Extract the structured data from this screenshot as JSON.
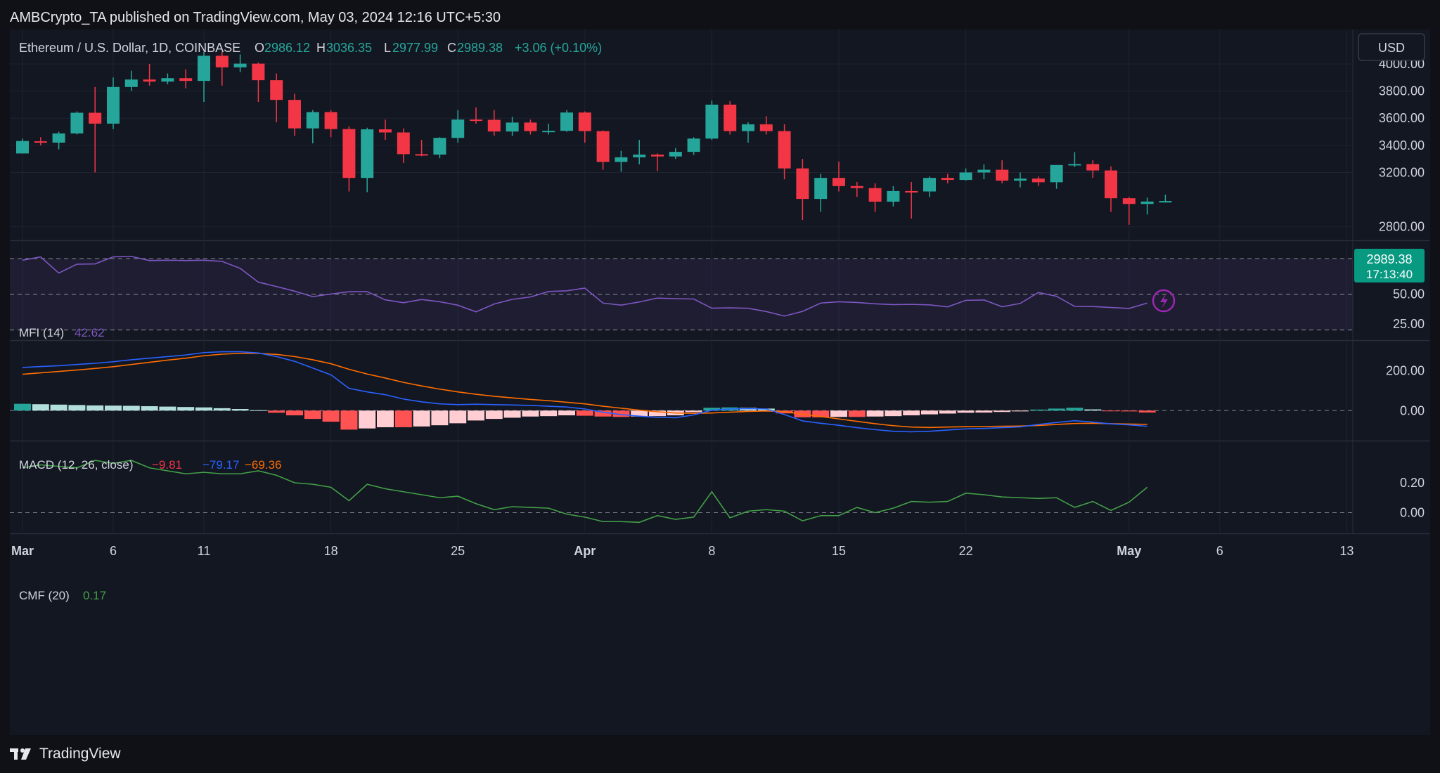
{
  "publish_line": "AMBCrypto_TA published on TradingView.com, May 03, 2024 12:16 UTC+5:30",
  "footer_brand": "TradingView",
  "colors": {
    "background": "#131722",
    "up": "#26a69a",
    "down": "#f23645",
    "mfi": "#7e57c2",
    "macd": "#2962ff",
    "signal": "#ff6d00",
    "cmf": "#43a047",
    "price_badge": "#089981"
  },
  "header": {
    "symbol": "Ethereum / U.S. Dollar, 1D, COINBASE",
    "o_label": "O",
    "o_value": "2986.12",
    "h_label": "H",
    "h_value": "3036.35",
    "l_label": "L",
    "l_value": "2977.99",
    "c_label": "C",
    "c_value": "2989.38",
    "change": "+3.06 (+0.10%)"
  },
  "currency_button": "USD",
  "last_price": {
    "price": "2989.38",
    "countdown": "17:13:40"
  },
  "chart_data": [
    {
      "type": "candlestick",
      "title": "Ethereum / U.S. Dollar, 1D, COINBASE",
      "ylim": [
        2700,
        4150
      ],
      "y_ticks": [
        "2800.00",
        "3200.00",
        "3400.00",
        "3600.00",
        "3800.00",
        "4000.00"
      ],
      "x_ticks": [
        "Mar",
        "6",
        "11",
        "18",
        "25",
        "Apr",
        "8",
        "15",
        "22",
        "May",
        "6",
        "13"
      ],
      "candles": [
        {
          "date": "2024-03-01",
          "o": 3340,
          "h": 3450,
          "l": 3340,
          "c": 3432
        },
        {
          "date": "2024-03-02",
          "o": 3430,
          "h": 3460,
          "l": 3400,
          "c": 3420
        },
        {
          "date": "2024-03-03",
          "o": 3420,
          "h": 3500,
          "l": 3370,
          "c": 3488
        },
        {
          "date": "2024-03-04",
          "o": 3488,
          "h": 3650,
          "l": 3480,
          "c": 3640
        },
        {
          "date": "2024-03-05",
          "o": 3640,
          "h": 3830,
          "l": 3200,
          "c": 3560
        },
        {
          "date": "2024-03-06",
          "o": 3560,
          "h": 3900,
          "l": 3520,
          "c": 3830
        },
        {
          "date": "2024-03-07",
          "o": 3830,
          "h": 3950,
          "l": 3800,
          "c": 3885
        },
        {
          "date": "2024-03-08",
          "o": 3885,
          "h": 4000,
          "l": 3840,
          "c": 3870
        },
        {
          "date": "2024-03-09",
          "o": 3870,
          "h": 3930,
          "l": 3850,
          "c": 3895
        },
        {
          "date": "2024-03-10",
          "o": 3895,
          "h": 3960,
          "l": 3820,
          "c": 3875
        },
        {
          "date": "2024-03-11",
          "o": 3875,
          "h": 4090,
          "l": 3720,
          "c": 4060
        },
        {
          "date": "2024-03-12",
          "o": 4060,
          "h": 4090,
          "l": 3840,
          "c": 3975
        },
        {
          "date": "2024-03-13",
          "o": 3975,
          "h": 4070,
          "l": 3940,
          "c": 4002
        },
        {
          "date": "2024-03-14",
          "o": 4002,
          "h": 4010,
          "l": 3720,
          "c": 3880
        },
        {
          "date": "2024-03-15",
          "o": 3880,
          "h": 3930,
          "l": 3570,
          "c": 3735
        },
        {
          "date": "2024-03-16",
          "o": 3735,
          "h": 3780,
          "l": 3470,
          "c": 3525
        },
        {
          "date": "2024-03-17",
          "o": 3525,
          "h": 3660,
          "l": 3415,
          "c": 3645
        },
        {
          "date": "2024-03-18",
          "o": 3645,
          "h": 3660,
          "l": 3460,
          "c": 3520
        },
        {
          "date": "2024-03-19",
          "o": 3520,
          "h": 3540,
          "l": 3060,
          "c": 3160
        },
        {
          "date": "2024-03-20",
          "o": 3160,
          "h": 3530,
          "l": 3055,
          "c": 3518
        },
        {
          "date": "2024-03-21",
          "o": 3518,
          "h": 3590,
          "l": 3440,
          "c": 3495
        },
        {
          "date": "2024-03-22",
          "o": 3495,
          "h": 3525,
          "l": 3270,
          "c": 3335
        },
        {
          "date": "2024-03-23",
          "o": 3335,
          "h": 3440,
          "l": 3320,
          "c": 3332
        },
        {
          "date": "2024-03-24",
          "o": 3332,
          "h": 3460,
          "l": 3305,
          "c": 3455
        },
        {
          "date": "2024-03-25",
          "o": 3455,
          "h": 3660,
          "l": 3420,
          "c": 3590
        },
        {
          "date": "2024-03-26",
          "o": 3590,
          "h": 3680,
          "l": 3560,
          "c": 3588
        },
        {
          "date": "2024-03-27",
          "o": 3588,
          "h": 3660,
          "l": 3470,
          "c": 3502
        },
        {
          "date": "2024-03-28",
          "o": 3502,
          "h": 3610,
          "l": 3470,
          "c": 3568
        },
        {
          "date": "2024-03-29",
          "o": 3568,
          "h": 3590,
          "l": 3480,
          "c": 3505
        },
        {
          "date": "2024-03-30",
          "o": 3505,
          "h": 3560,
          "l": 3480,
          "c": 3507
        },
        {
          "date": "2024-03-31",
          "o": 3507,
          "h": 3660,
          "l": 3500,
          "c": 3642
        },
        {
          "date": "2024-04-01",
          "o": 3642,
          "h": 3650,
          "l": 3420,
          "c": 3505
        },
        {
          "date": "2024-04-02",
          "o": 3505,
          "h": 3510,
          "l": 3220,
          "c": 3278
        },
        {
          "date": "2024-04-03",
          "o": 3278,
          "h": 3360,
          "l": 3205,
          "c": 3312
        },
        {
          "date": "2024-04-04",
          "o": 3312,
          "h": 3440,
          "l": 3260,
          "c": 3332
        },
        {
          "date": "2024-04-05",
          "o": 3332,
          "h": 3340,
          "l": 3210,
          "c": 3318
        },
        {
          "date": "2024-04-06",
          "o": 3318,
          "h": 3380,
          "l": 3300,
          "c": 3352
        },
        {
          "date": "2024-04-07",
          "o": 3352,
          "h": 3460,
          "l": 3330,
          "c": 3450
        },
        {
          "date": "2024-04-08",
          "o": 3450,
          "h": 3730,
          "l": 3440,
          "c": 3700
        },
        {
          "date": "2024-04-09",
          "o": 3700,
          "h": 3725,
          "l": 3480,
          "c": 3505
        },
        {
          "date": "2024-04-10",
          "o": 3505,
          "h": 3570,
          "l": 3420,
          "c": 3555
        },
        {
          "date": "2024-04-11",
          "o": 3555,
          "h": 3615,
          "l": 3480,
          "c": 3505
        },
        {
          "date": "2024-04-12",
          "o": 3505,
          "h": 3555,
          "l": 3150,
          "c": 3230
        },
        {
          "date": "2024-04-13",
          "o": 3230,
          "h": 3300,
          "l": 2850,
          "c": 3005
        },
        {
          "date": "2024-04-14",
          "o": 3005,
          "h": 3190,
          "l": 2910,
          "c": 3160
        },
        {
          "date": "2024-04-15",
          "o": 3160,
          "h": 3280,
          "l": 3060,
          "c": 3100
        },
        {
          "date": "2024-04-16",
          "o": 3100,
          "h": 3130,
          "l": 3020,
          "c": 3085
        },
        {
          "date": "2024-04-17",
          "o": 3085,
          "h": 3120,
          "l": 2910,
          "c": 2985
        },
        {
          "date": "2024-04-18",
          "o": 2985,
          "h": 3100,
          "l": 2950,
          "c": 3063
        },
        {
          "date": "2024-04-19",
          "o": 3063,
          "h": 3130,
          "l": 2860,
          "c": 3060
        },
        {
          "date": "2024-04-20",
          "o": 3060,
          "h": 3170,
          "l": 3020,
          "c": 3160
        },
        {
          "date": "2024-04-21",
          "o": 3160,
          "h": 3190,
          "l": 3120,
          "c": 3145
        },
        {
          "date": "2024-04-22",
          "o": 3145,
          "h": 3230,
          "l": 3140,
          "c": 3200
        },
        {
          "date": "2024-04-23",
          "o": 3200,
          "h": 3260,
          "l": 3150,
          "c": 3220
        },
        {
          "date": "2024-04-24",
          "o": 3220,
          "h": 3290,
          "l": 3120,
          "c": 3140
        },
        {
          "date": "2024-04-25",
          "o": 3140,
          "h": 3200,
          "l": 3090,
          "c": 3155
        },
        {
          "date": "2024-04-26",
          "o": 3155,
          "h": 3170,
          "l": 3100,
          "c": 3128
        },
        {
          "date": "2024-04-27",
          "o": 3128,
          "h": 3250,
          "l": 3080,
          "c": 3255
        },
        {
          "date": "2024-04-28",
          "o": 3255,
          "h": 3350,
          "l": 3240,
          "c": 3262
        },
        {
          "date": "2024-04-29",
          "o": 3262,
          "h": 3290,
          "l": 3160,
          "c": 3215
        },
        {
          "date": "2024-04-30",
          "o": 3215,
          "h": 3245,
          "l": 2910,
          "c": 3010
        },
        {
          "date": "2024-05-01",
          "o": 3010,
          "h": 3020,
          "l": 2815,
          "c": 2968
        },
        {
          "date": "2024-05-02",
          "o": 2968,
          "h": 3015,
          "l": 2890,
          "c": 2986
        },
        {
          "date": "2024-05-03",
          "o": 2986.12,
          "h": 3036.35,
          "l": 2977.99,
          "c": 2989.38
        }
      ]
    },
    {
      "type": "line",
      "title": "MFI (14)",
      "value_label": "42.62",
      "ylim": [
        15,
        90
      ],
      "y_ticks": [
        "25.00",
        "50.00",
        "75.00"
      ],
      "bands": [
        20,
        50,
        80
      ],
      "values": [
        78.6,
        81.4,
        67.8,
        75.3,
        75.5,
        81.4,
        81.8,
        78.3,
        78.6,
        78.3,
        78.6,
        77.6,
        71.8,
        60.2,
        56.5,
        52.6,
        48.0,
        50.2,
        52.1,
        52.2,
        45.3,
        42.9,
        45.6,
        43.7,
        40.8,
        35.2,
        41.8,
        45.7,
        47.7,
        52.3,
        52.9,
        55.2,
        42.6,
        40.9,
        43.5,
        46.8,
        46.3,
        46.0,
        38.3,
        38.6,
        38.2,
        35.5,
        31.7,
        35.6,
        42.6,
        43.7,
        43.1,
        42.0,
        41.3,
        41.5,
        41.1,
        39.4,
        44.9,
        45.2,
        39.5,
        42.3,
        51.5,
        48.3,
        39.8,
        39.7,
        38.9,
        38.1,
        42.6
      ]
    },
    {
      "type": "line",
      "title": "MACD (12, 26, close)",
      "value_labels": [
        "−9.81",
        "−79.17",
        "−69.36"
      ],
      "ylim": [
        -130,
        330
      ],
      "y_ticks": [
        "0.00",
        "200.00"
      ],
      "series": [
        {
          "values": [
            217,
            222,
            226,
            232,
            238,
            246,
            256,
            264,
            272,
            280,
            292,
            296,
            296,
            290,
            272,
            248,
            214,
            180,
            112,
            94,
            80,
            58,
            44,
            34,
            30,
            32,
            30,
            28,
            26,
            22,
            18,
            8,
            -8,
            -20,
            -28,
            -34,
            -36,
            -22,
            2,
            8,
            10,
            8,
            -20,
            -52,
            -64,
            -74,
            -86,
            -96,
            -104,
            -107,
            -104,
            -98,
            -92,
            -90,
            -86,
            -82,
            -70,
            -60,
            -51,
            -58,
            -67,
            -72,
            -79.17
          ]
        },
        {
          "values": [
            183,
            190,
            197,
            204,
            212,
            221,
            232,
            243,
            254,
            264,
            276,
            284,
            288,
            288,
            283,
            272,
            256,
            236,
            208,
            184,
            164,
            142,
            124,
            108,
            94,
            82,
            72,
            64,
            56,
            50,
            42,
            34,
            22,
            12,
            2,
            -6,
            -12,
            -14,
            -12,
            -8,
            -4,
            -2,
            -6,
            -18,
            -30,
            -42,
            -54,
            -66,
            -76,
            -83,
            -85,
            -83,
            -81,
            -80,
            -79,
            -78,
            -75,
            -70,
            -65,
            -64,
            -66,
            -68,
            -69.36
          ]
        },
        {
          "type": "bar",
          "values": [
            34,
            32,
            30,
            28,
            26,
            25,
            24,
            22,
            20,
            18,
            16,
            12,
            8,
            2,
            -11,
            -24,
            -42,
            -56,
            -96,
            -90,
            -84,
            -84,
            -80,
            -74,
            -64,
            -50,
            -42,
            -36,
            -30,
            -28,
            -24,
            -26,
            -30,
            -32,
            -30,
            -28,
            -24,
            -8,
            14,
            16,
            14,
            10,
            -14,
            -34,
            -34,
            -32,
            -32,
            -30,
            -28,
            -24,
            -19,
            -15,
            -11,
            -10,
            -7,
            -4,
            5,
            10,
            14,
            6,
            -1,
            -4,
            -9.81
          ]
        }
      ]
    },
    {
      "type": "line",
      "title": "CMF (20)",
      "value_label": "0.17",
      "ylim": [
        -0.12,
        0.44
      ],
      "y_ticks": [
        "0.00",
        "0.20"
      ],
      "values": [
        0.3,
        0.32,
        0.31,
        0.3,
        0.35,
        0.33,
        0.35,
        0.3,
        0.28,
        0.26,
        0.27,
        0.26,
        0.26,
        0.28,
        0.25,
        0.2,
        0.19,
        0.17,
        0.08,
        0.19,
        0.16,
        0.14,
        0.12,
        0.1,
        0.11,
        0.06,
        0.02,
        0.04,
        0.035,
        0.03,
        -0.01,
        -0.03,
        -0.06,
        -0.06,
        -0.065,
        -0.02,
        -0.045,
        -0.03,
        0.14,
        -0.035,
        0.01,
        0.02,
        0.01,
        -0.055,
        -0.02,
        -0.02,
        0.035,
        0.0,
        0.03,
        0.075,
        0.07,
        0.075,
        0.13,
        0.12,
        0.105,
        0.1,
        0.095,
        0.1,
        0.035,
        0.075,
        0.015,
        0.07,
        0.17
      ]
    }
  ],
  "mfi_text": {
    "title": "MFI (14)",
    "value": "42.62"
  },
  "macd_text": {
    "title": "MACD (12, 26, close)",
    "hist": "−9.81",
    "macd": "−79.17",
    "signal": "−69.36"
  },
  "cmf_text": {
    "title": "CMF (20)",
    "value": "0.17"
  }
}
